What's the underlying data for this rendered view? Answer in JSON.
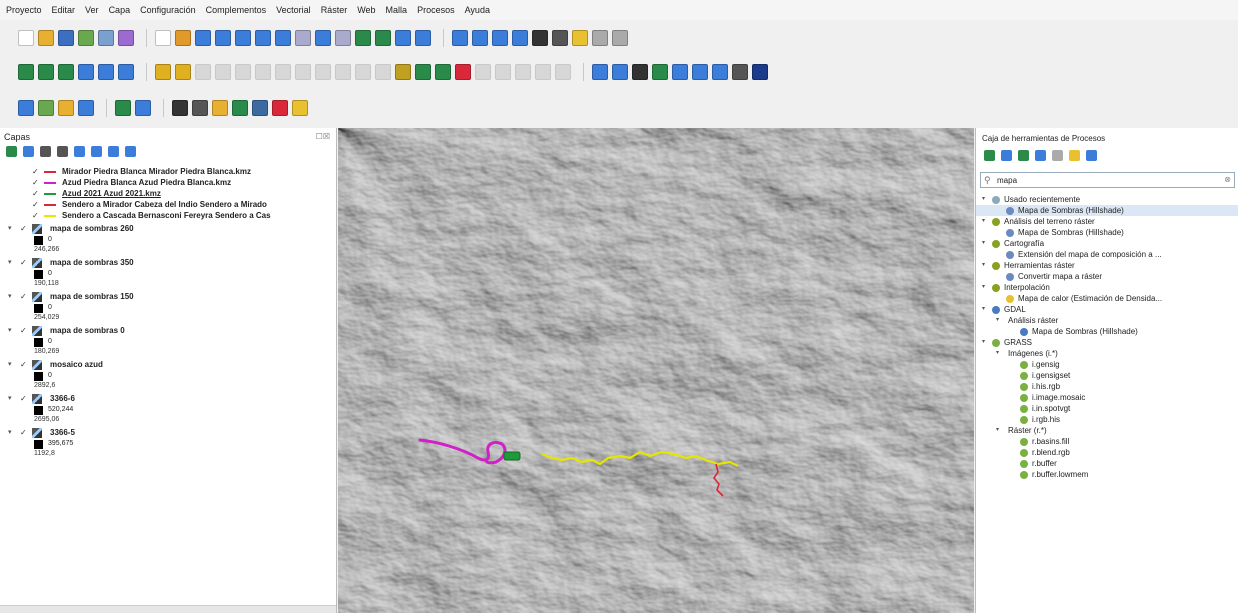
{
  "menu": [
    "Proyecto",
    "Editar",
    "Ver",
    "Capa",
    "Configuración",
    "Complementos",
    "Vectorial",
    "Ráster",
    "Web",
    "Malla",
    "Procesos",
    "Ayuda"
  ],
  "colors": {
    "accent": "#3b7dd8",
    "map_bg": "#5a5a5a",
    "magenta": "#d020c8",
    "green": "#1f9a3a",
    "yellow": "#e6e600",
    "red": "#d8283a"
  },
  "layers_panel": {
    "title": "Capas",
    "vector_layers": [
      {
        "name": "Mirador Piedra Blanca Mirador Piedra Blanca.kmz",
        "color": "#d8283a"
      },
      {
        "name": "Azud Piedra Blanca Azud Piedra Blanca.kmz",
        "color": "#d020c8"
      },
      {
        "name": "Azud 2021 Azud 2021.kmz",
        "color": "#1f9a3a"
      },
      {
        "name": "Sendero a Mirador Cabeza del Indio Sendero a Mirado",
        "color": "#d8283a"
      },
      {
        "name": "Sendero a Cascada Bernasconi Fereyra Sendero a Cas",
        "color": "#e6e600"
      }
    ],
    "raster_layers": [
      {
        "name": "mapa de sombras 260",
        "min": "0",
        "max": "246,266"
      },
      {
        "name": "mapa de sombras 350",
        "min": "0",
        "max": "190,118"
      },
      {
        "name": "mapa de sombras 150",
        "min": "0",
        "max": "254,029"
      },
      {
        "name": "mapa de sombras 0",
        "min": "0",
        "max": "180,269"
      },
      {
        "name": "mosaico azud",
        "min": "0",
        "max": "2892,6"
      },
      {
        "name": "3366-6",
        "min": "520,244",
        "max": "2695,06"
      },
      {
        "name": "3366-5",
        "min": "395,675",
        "max": "1192,8"
      }
    ]
  },
  "toolbox": {
    "title": "Caja de herramientas de Procesos",
    "search_value": "mapa",
    "tree": [
      {
        "level": 0,
        "label": "Usado recientemente",
        "icon": "clock"
      },
      {
        "level": 1,
        "label": "Mapa de Sombras (Hillshade)",
        "icon": "gear",
        "selected": true
      },
      {
        "level": 0,
        "label": "Análisis del terreno ráster",
        "icon": "q"
      },
      {
        "level": 1,
        "label": "Mapa de Sombras (Hillshade)",
        "icon": "gear"
      },
      {
        "level": 0,
        "label": "Cartografía",
        "icon": "q"
      },
      {
        "level": 1,
        "label": "Extensión del mapa de composición a ...",
        "icon": "gear"
      },
      {
        "level": 0,
        "label": "Herramientas ráster",
        "icon": "q"
      },
      {
        "level": 1,
        "label": "Convertir mapa a ráster",
        "icon": "gear"
      },
      {
        "level": 0,
        "label": "Interpolación",
        "icon": "q"
      },
      {
        "level": 1,
        "label": "Mapa de calor (Estimación de Densida...",
        "icon": "heat"
      },
      {
        "level": 0,
        "label": "GDAL",
        "icon": "gdal"
      },
      {
        "level": 1,
        "label": "Análisis ráster",
        "icon": "none"
      },
      {
        "level": 2,
        "label": "Mapa de Sombras (Hillshade)",
        "icon": "gdal"
      },
      {
        "level": 0,
        "label": "GRASS",
        "icon": "grass"
      },
      {
        "level": 1,
        "label": "Imágenes (i.*)",
        "icon": "none"
      },
      {
        "level": 2,
        "label": "i.gensig",
        "icon": "grass"
      },
      {
        "level": 2,
        "label": "i.gensigset",
        "icon": "grass"
      },
      {
        "level": 2,
        "label": "i.his.rgb",
        "icon": "grass"
      },
      {
        "level": 2,
        "label": "i.image.mosaic",
        "icon": "grass"
      },
      {
        "level": 2,
        "label": "i.in.spotvgt",
        "icon": "grass"
      },
      {
        "level": 2,
        "label": "i.rgb.his",
        "icon": "grass"
      },
      {
        "level": 1,
        "label": "Ráster (r.*)",
        "icon": "none"
      },
      {
        "level": 2,
        "label": "r.basins.fill",
        "icon": "grass"
      },
      {
        "level": 2,
        "label": "r.blend.rgb",
        "icon": "grass"
      },
      {
        "level": 2,
        "label": "r.buffer",
        "icon": "grass"
      },
      {
        "level": 2,
        "label": "r.buffer.lowmem",
        "icon": "grass"
      }
    ]
  }
}
